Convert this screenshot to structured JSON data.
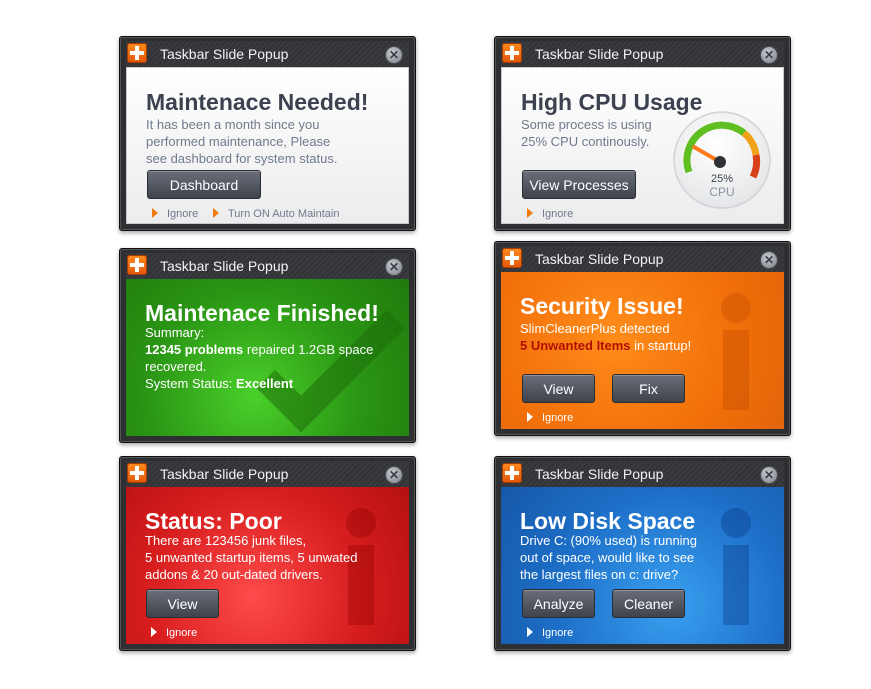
{
  "popup_title": "Taskbar Slide Popup",
  "close_glyph": "✕",
  "popups": {
    "maintenance_needed": {
      "heading": "Maintenace Needed!",
      "lines": [
        "It has been a month since you",
        "performed maintenance, Please",
        "see dashboard for system status."
      ],
      "button": "Dashboard",
      "links": [
        "Ignore",
        "Turn ON Auto Maintain"
      ]
    },
    "high_cpu": {
      "heading": "High CPU Usage",
      "lines": [
        "Some process is using",
        "25% CPU continously."
      ],
      "button": "View Processes",
      "link": "Ignore",
      "gauge": {
        "percent": 25,
        "value_label": "25%",
        "unit_label": "CPU"
      }
    },
    "maintenance_finished": {
      "heading": "Maintenace Finished!",
      "summary_label": "Summary:",
      "problems_count": "12345 problems",
      "problems_rest": " repaired 1.2GB space",
      "recovered": "recovered.",
      "status_label": "System Status: ",
      "status_value": "Excellent"
    },
    "security_issue": {
      "heading": "Security Issue!",
      "line1": "SlimCleanerPlus detected",
      "unwanted": "5 Unwanted Items",
      "unwanted_rest": " in startup!",
      "buttons": [
        "View",
        "Fix"
      ],
      "link": "Ignore"
    },
    "status_poor": {
      "heading": "Status: Poor",
      "lines": [
        "There are 123456 junk files,",
        "5 unwanted startup items, 5 unwated",
        "addons & 20 out-dated drivers."
      ],
      "button": "View",
      "link": "Ignore"
    },
    "low_disk": {
      "heading": "Low Disk Space",
      "lines": [
        "Drive C: (90% used) is running",
        "out of space, would like to see",
        "the largest files on c: drive?"
      ],
      "buttons": [
        "Analyze",
        "Cleaner"
      ],
      "link": "Ignore"
    }
  },
  "colors": {
    "accent": "#ef7c11",
    "green": "#2a9514",
    "orange": "#f2700a",
    "red": "#d81e1e",
    "blue": "#1d6fc7",
    "warning_text": "#b30f00"
  }
}
